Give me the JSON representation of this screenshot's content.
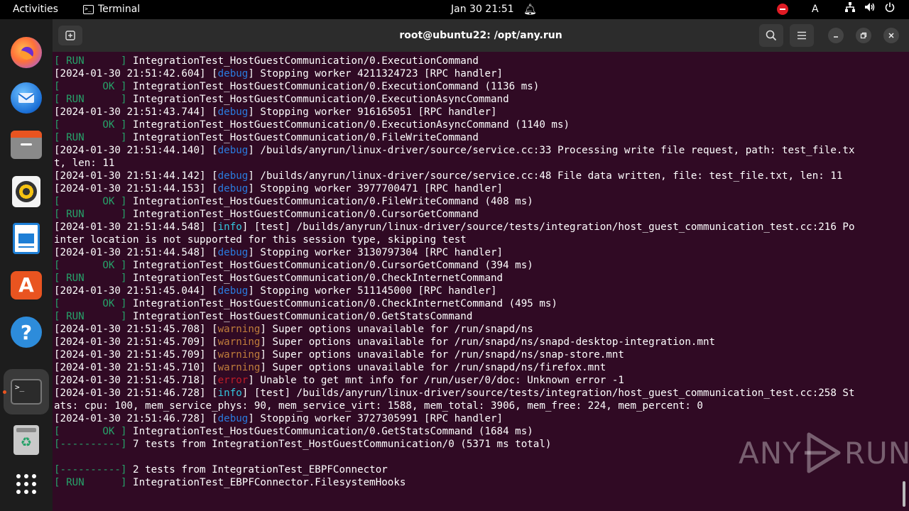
{
  "topbar": {
    "activities": "Activities",
    "app_name": "Terminal",
    "clock": "Jan 30  21:51",
    "input_source": "A"
  },
  "dock": {
    "items": [
      "firefox",
      "thunderbird",
      "files",
      "rhythmbox",
      "libreoffice-writer",
      "app-center",
      "help",
      "terminal",
      "trash",
      "show-apps"
    ]
  },
  "window": {
    "title": "root@ubuntu22: /opt/any.run"
  },
  "colors": {
    "ok_green": "#26a269",
    "debug_blue": "#2a7bde",
    "info_cyan": "#33c7de",
    "warning_orange": "#c07d3b",
    "error_red": "#c01c28",
    "terminal_bg": "#300a24"
  },
  "terminal": {
    "lines": [
      [
        {
          "t": "[ RUN      ]",
          "c": "g"
        },
        {
          "t": " IntegrationTest_HostGuestCommunication/0.ExecutionCommand"
        }
      ],
      [
        {
          "t": "[2024-01-30 21:51:42.604] ["
        },
        {
          "t": "debug",
          "c": "dbg"
        },
        {
          "t": "] Stopping worker 4211324723 [RPC handler]"
        }
      ],
      [
        {
          "t": "[       OK ]",
          "c": "g"
        },
        {
          "t": " IntegrationTest_HostGuestCommunication/0.ExecutionCommand (1136 ms)"
        }
      ],
      [
        {
          "t": "[ RUN      ]",
          "c": "g"
        },
        {
          "t": " IntegrationTest_HostGuestCommunication/0.ExecutionAsyncCommand"
        }
      ],
      [
        {
          "t": "[2024-01-30 21:51:43.744] ["
        },
        {
          "t": "debug",
          "c": "dbg"
        },
        {
          "t": "] Stopping worker 916165051 [RPC handler]"
        }
      ],
      [
        {
          "t": "[       OK ]",
          "c": "g"
        },
        {
          "t": " IntegrationTest_HostGuestCommunication/0.ExecutionAsyncCommand (1140 ms)"
        }
      ],
      [
        {
          "t": "[ RUN      ]",
          "c": "g"
        },
        {
          "t": " IntegrationTest_HostGuestCommunication/0.FileWriteCommand"
        }
      ],
      [
        {
          "t": "[2024-01-30 21:51:44.140] ["
        },
        {
          "t": "debug",
          "c": "dbg"
        },
        {
          "t": "] /builds/anyrun/linux-driver/source/service.cc:33 Processing write file request, path: test_file.tx"
        }
      ],
      [
        {
          "t": "t, len: 11"
        }
      ],
      [
        {
          "t": "[2024-01-30 21:51:44.142] ["
        },
        {
          "t": "debug",
          "c": "dbg"
        },
        {
          "t": "] /builds/anyrun/linux-driver/source/service.cc:48 File data written, file: test_file.txt, len: 11"
        }
      ],
      [
        {
          "t": "[2024-01-30 21:51:44.153] ["
        },
        {
          "t": "debug",
          "c": "dbg"
        },
        {
          "t": "] Stopping worker 3977700471 [RPC handler]"
        }
      ],
      [
        {
          "t": "[       OK ]",
          "c": "g"
        },
        {
          "t": " IntegrationTest_HostGuestCommunication/0.FileWriteCommand (408 ms)"
        }
      ],
      [
        {
          "t": "[ RUN      ]",
          "c": "g"
        },
        {
          "t": " IntegrationTest_HostGuestCommunication/0.CursorGetCommand"
        }
      ],
      [
        {
          "t": "[2024-01-30 21:51:44.548] ["
        },
        {
          "t": "info",
          "c": "inf"
        },
        {
          "t": "] [test] /builds/anyrun/linux-driver/source/tests/integration/host_guest_communication_test.cc:216 Po"
        }
      ],
      [
        {
          "t": "inter location is not supported for this session type, skipping test"
        }
      ],
      [
        {
          "t": "[2024-01-30 21:51:44.548] ["
        },
        {
          "t": "debug",
          "c": "dbg"
        },
        {
          "t": "] Stopping worker 3130797304 [RPC handler]"
        }
      ],
      [
        {
          "t": "[       OK ]",
          "c": "g"
        },
        {
          "t": " IntegrationTest_HostGuestCommunication/0.CursorGetCommand (394 ms)"
        }
      ],
      [
        {
          "t": "[ RUN      ]",
          "c": "g"
        },
        {
          "t": " IntegrationTest_HostGuestCommunication/0.CheckInternetCommand"
        }
      ],
      [
        {
          "t": "[2024-01-30 21:51:45.044] ["
        },
        {
          "t": "debug",
          "c": "dbg"
        },
        {
          "t": "] Stopping worker 511145000 [RPC handler]"
        }
      ],
      [
        {
          "t": "[       OK ]",
          "c": "g"
        },
        {
          "t": " IntegrationTest_HostGuestCommunication/0.CheckInternetCommand (495 ms)"
        }
      ],
      [
        {
          "t": "[ RUN      ]",
          "c": "g"
        },
        {
          "t": " IntegrationTest_HostGuestCommunication/0.GetStatsCommand"
        }
      ],
      [
        {
          "t": "[2024-01-30 21:51:45.708] ["
        },
        {
          "t": "warning",
          "c": "wrn"
        },
        {
          "t": "] Super options unavailable for /run/snapd/ns"
        }
      ],
      [
        {
          "t": "[2024-01-30 21:51:45.709] ["
        },
        {
          "t": "warning",
          "c": "wrn"
        },
        {
          "t": "] Super options unavailable for /run/snapd/ns/snapd-desktop-integration.mnt"
        }
      ],
      [
        {
          "t": "[2024-01-30 21:51:45.709] ["
        },
        {
          "t": "warning",
          "c": "wrn"
        },
        {
          "t": "] Super options unavailable for /run/snapd/ns/snap-store.mnt"
        }
      ],
      [
        {
          "t": "[2024-01-30 21:51:45.710] ["
        },
        {
          "t": "warning",
          "c": "wrn"
        },
        {
          "t": "] Super options unavailable for /run/snapd/ns/firefox.mnt"
        }
      ],
      [
        {
          "t": "[2024-01-30 21:51:45.718] ["
        },
        {
          "t": "error",
          "c": "err"
        },
        {
          "t": "] Unable to get mnt info for /run/user/0/doc: Unknown error -1"
        }
      ],
      [
        {
          "t": "[2024-01-30 21:51:46.728] ["
        },
        {
          "t": "info",
          "c": "inf"
        },
        {
          "t": "] [test] /builds/anyrun/linux-driver/source/tests/integration/host_guest_communication_test.cc:258 St"
        }
      ],
      [
        {
          "t": "ats: cpu: 100, mem_service_phys: 90, mem_service_virt: 1588, mem_total: 3906, mem_free: 224, mem_percent: 0"
        }
      ],
      [
        {
          "t": "[2024-01-30 21:51:46.728] ["
        },
        {
          "t": "debug",
          "c": "dbg"
        },
        {
          "t": "] Stopping worker 3727305991 [RPC handler]"
        }
      ],
      [
        {
          "t": "[       OK ]",
          "c": "g"
        },
        {
          "t": " IntegrationTest_HostGuestCommunication/0.GetStatsCommand (1684 ms)"
        }
      ],
      [
        {
          "t": "[----------]",
          "c": "g"
        },
        {
          "t": " 7 tests from IntegrationTest_HostGuestCommunication/0 (5371 ms total)"
        }
      ],
      [
        {
          "t": ""
        }
      ],
      [
        {
          "t": "[----------]",
          "c": "g"
        },
        {
          "t": " 2 tests from IntegrationTest_EBPFConnector"
        }
      ],
      [
        {
          "t": "[ RUN      ]",
          "c": "g"
        },
        {
          "t": " IntegrationTest_EBPFConnector.FilesystemHooks"
        }
      ]
    ]
  },
  "watermark": {
    "left": "ANY",
    "right": "RUN"
  }
}
